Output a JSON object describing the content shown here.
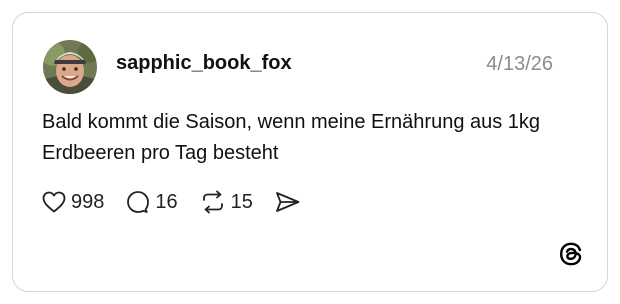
{
  "post": {
    "username": "sapphic_book_fox",
    "date": "4/13/26",
    "text": "Bald kommt die Saison, wenn meine Ernährung aus 1kg Erdbeeren pro Tag besteht"
  },
  "actions": {
    "likes": "998",
    "replies": "16",
    "reposts": "15"
  },
  "icons": {
    "like": "heart-icon",
    "reply": "speech-bubble-icon",
    "repost": "repost-arrows-icon",
    "share": "send-icon",
    "brand": "threads-logo-icon"
  },
  "colors": {
    "text": "#111111",
    "muted": "#8c8c8c",
    "border": "#d5d5d5"
  }
}
